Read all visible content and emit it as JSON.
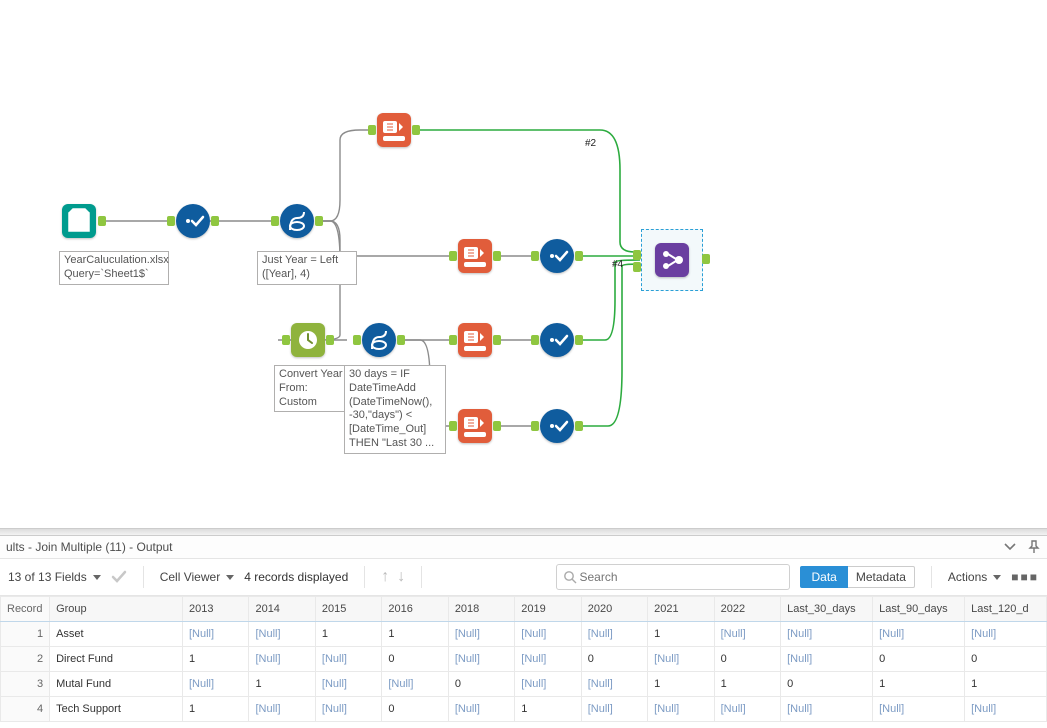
{
  "canvas": {
    "annotations": {
      "input": "YearCaluculation.xlsx\nQuery=`Sheet1$`",
      "formula1": "Just Year = Left\n([Year], 4)",
      "datetime": "Convert Year\nFrom:\nCustom",
      "formula2": "30 days = IF\nDateTimeAdd\n(DateTimeNow(),\n-30,\"days\") <\n[DateTime_Out]\nTHEN \"Last 30 ..."
    },
    "anchor_labels": {
      "top": "#2",
      "mid": "#4"
    }
  },
  "results": {
    "title": "ults - Join Multiple (11) - Output",
    "fields_summary": "13 of 13 Fields",
    "cell_viewer": "Cell Viewer",
    "records_summary": "4 records displayed",
    "search_placeholder": "Search",
    "btn_data": "Data",
    "btn_metadata": "Metadata",
    "btn_actions": "Actions",
    "columns": [
      "Record",
      "Group",
      "2013",
      "2014",
      "2015",
      "2016",
      "2018",
      "2019",
      "2020",
      "2021",
      "2022",
      "Last_30_days",
      "Last_90_days",
      "Last_120_d"
    ],
    "rows": [
      {
        "Record": "1",
        "Group": "Asset",
        "2013": "[Null]",
        "2014": "[Null]",
        "2015": "1",
        "2016": "1",
        "2018": "[Null]",
        "2019": "[Null]",
        "2020": "[Null]",
        "2021": "1",
        "2022": "[Null]",
        "Last_30_days": "[Null]",
        "Last_90_days": "[Null]",
        "Last_120_d": "[Null]"
      },
      {
        "Record": "2",
        "Group": "Direct Fund",
        "2013": "1",
        "2014": "[Null]",
        "2015": "[Null]",
        "2016": "0",
        "2018": "[Null]",
        "2019": "[Null]",
        "2020": "0",
        "2021": "[Null]",
        "2022": "0",
        "Last_30_days": "[Null]",
        "Last_90_days": "0",
        "Last_120_d": "0"
      },
      {
        "Record": "3",
        "Group": "Mutal Fund",
        "2013": "[Null]",
        "2014": "1",
        "2015": "[Null]",
        "2016": "[Null]",
        "2018": "0",
        "2019": "[Null]",
        "2020": "[Null]",
        "2021": "1",
        "2022": "1",
        "Last_30_days": "0",
        "Last_90_days": "1",
        "Last_120_d": "1"
      },
      {
        "Record": "4",
        "Group": "Tech Support",
        "2013": "1",
        "2014": "[Null]",
        "2015": "[Null]",
        "2016": "0",
        "2018": "[Null]",
        "2019": "1",
        "2020": "[Null]",
        "2021": "[Null]",
        "2022": "[Null]",
        "Last_30_days": "[Null]",
        "Last_90_days": "[Null]",
        "Last_120_d": "[Null]"
      }
    ]
  }
}
